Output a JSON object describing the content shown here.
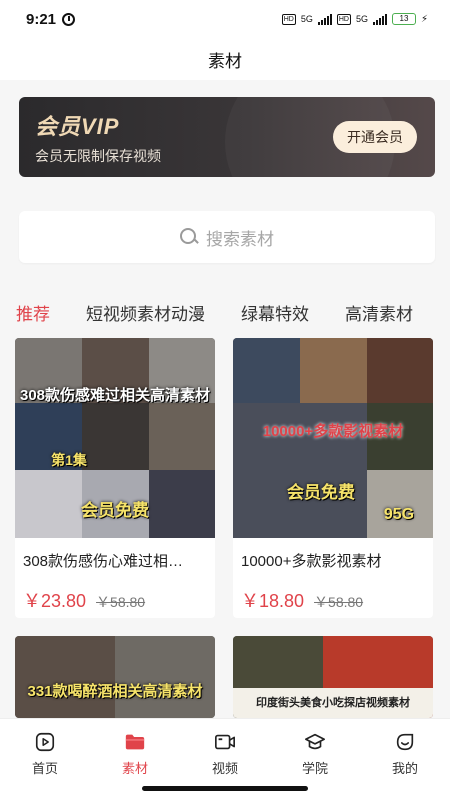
{
  "status": {
    "time": "9:21",
    "hd1": "HD",
    "net1": "5G",
    "hd2": "HD",
    "net2": "5G",
    "battery": "13"
  },
  "header": {
    "title": "素材"
  },
  "vip": {
    "title": "会员VIP",
    "subtitle": "会员无限制保存视频",
    "button": "开通会员"
  },
  "search": {
    "placeholder": "搜索素材"
  },
  "tabs": [
    {
      "label": "推荐",
      "active": true
    },
    {
      "label": "短视频素材动漫",
      "active": false
    },
    {
      "label": "绿幕特效",
      "active": false
    },
    {
      "label": "高清素材",
      "active": false
    }
  ],
  "cards": [
    {
      "overlay_title": "308款伤感难过相关高清素材",
      "overlay_badge": "会员免费",
      "overlay_extra": "第1集",
      "title": "308款伤感伤心难过相…",
      "price": "￥23.80",
      "original_price": "￥58.80"
    },
    {
      "overlay_title": "10000+多款影视素材",
      "overlay_badge": "会员免费",
      "overlay_extra": "95G",
      "title": "10000+多款影视素材",
      "price": "￥18.80",
      "original_price": "￥58.80"
    },
    {
      "overlay_title": "331款喝醉酒相关高清素材"
    },
    {
      "overlay_title": "印度街头美食小吃探店视频素材"
    }
  ],
  "nav": [
    {
      "label": "首页",
      "icon": "play-square-icon",
      "active": false
    },
    {
      "label": "素材",
      "icon": "folder-icon",
      "active": true
    },
    {
      "label": "视频",
      "icon": "video-camera-icon",
      "active": false
    },
    {
      "label": "学院",
      "icon": "graduation-cap-icon",
      "active": false
    },
    {
      "label": "我的",
      "icon": "smile-face-icon",
      "active": false
    }
  ],
  "colors": {
    "accent": "#e0434a",
    "vip_gold": "#f0d9b5",
    "vip_dark": "#2b2a2c"
  }
}
